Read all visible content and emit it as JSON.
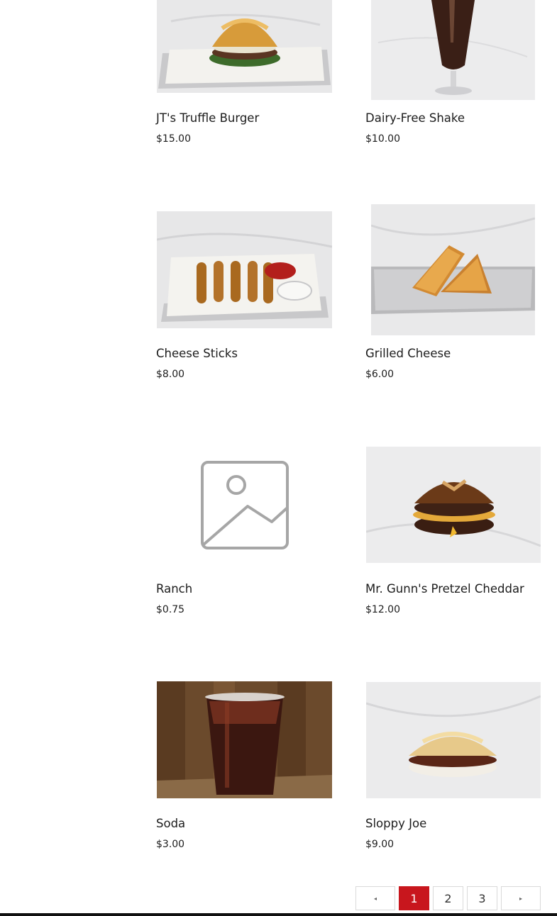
{
  "products": [
    {
      "title": "JT's Truffle Burger",
      "price": "$15.00",
      "image": "truffle-burger-photo"
    },
    {
      "title": "Dairy-Free Shake",
      "price": "$10.00",
      "image": "shake-photo"
    },
    {
      "title": "Cheese Sticks",
      "price": "$8.00",
      "image": "cheese-sticks-photo"
    },
    {
      "title": "Grilled Cheese",
      "price": "$6.00",
      "image": "grilled-cheese-photo"
    },
    {
      "title": "Ranch",
      "price": "$0.75",
      "image": "image-placeholder-icon"
    },
    {
      "title": "Mr. Gunn's Pretzel Cheddar",
      "price": "$12.00",
      "image": "pretzel-burger-photo"
    },
    {
      "title": "Soda",
      "price": "$3.00",
      "image": "soda-photo"
    },
    {
      "title": "Sloppy Joe",
      "price": "$9.00",
      "image": "sloppy-joe-photo"
    }
  ],
  "pagination": {
    "prev": "◂",
    "pages": [
      "1",
      "2",
      "3"
    ],
    "current": "1",
    "next": "▸"
  },
  "colors": {
    "accent": "#c8161d",
    "text": "#1c1c1c",
    "marble": "#e9e9ea"
  }
}
